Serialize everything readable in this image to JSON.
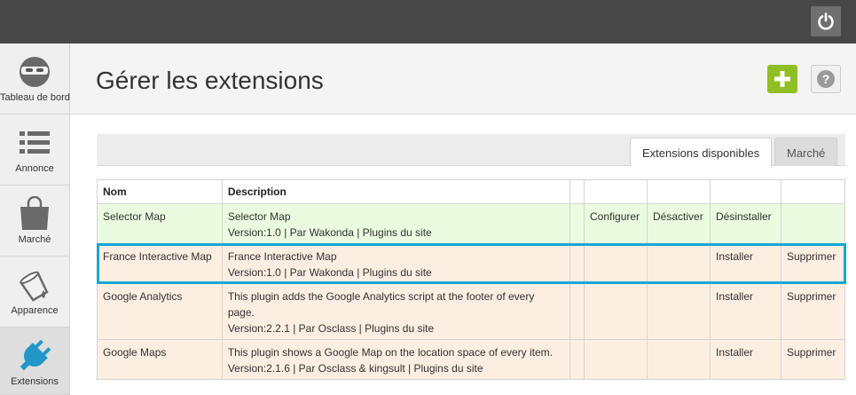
{
  "topbar": {
    "power_icon": "power-icon"
  },
  "sidebar": {
    "items": [
      {
        "label": "Tableau de bord",
        "icon": "ninja-icon"
      },
      {
        "label": "Annonce",
        "icon": "list-icon"
      },
      {
        "label": "Marché",
        "icon": "shopping-bag-icon"
      },
      {
        "label": "Apparence",
        "icon": "paint-bucket-icon"
      },
      {
        "label": "Extensions",
        "icon": "plug-icon"
      }
    ],
    "active": "Extensions"
  },
  "header": {
    "title": "Gérer les extensions",
    "add_icon": "plus-icon",
    "help_icon": "question-icon"
  },
  "tabs": [
    {
      "label": "Extensions disponibles",
      "active": true
    },
    {
      "label": "Marché",
      "active": false
    }
  ],
  "table": {
    "headers": [
      "Nom",
      "Description",
      "",
      "",
      "",
      "",
      ""
    ],
    "rows": [
      {
        "name": "Selector Map",
        "desc_line1": "Selector Map",
        "desc_line2": "Version:1.0 | Par Wakonda | Plugins du site",
        "desc_line3": "",
        "configure": "Configurer",
        "disable": "Désactiver",
        "action1": "Désinstaller",
        "action2": "",
        "status": "installed"
      },
      {
        "name": "France Interactive Map",
        "desc_line1": "France Interactive Map",
        "desc_line2": "Version:1.0 | Par Wakonda | Plugins du site",
        "desc_line3": "",
        "configure": "",
        "disable": "",
        "action1": "Installer",
        "action2": "Supprimer",
        "status": "not-installed",
        "selected": true
      },
      {
        "name": "Google Analytics",
        "desc_line1": "This plugin adds the Google Analytics script at the footer of every",
        "desc_line2": "page.",
        "desc_line3": "Version:2.2.1 | Par Osclass | Plugins du site",
        "configure": "",
        "disable": "",
        "action1": "Installer",
        "action2": "Supprimer",
        "status": "not-installed"
      },
      {
        "name": "Google Maps",
        "desc_line1": "This plugin shows a Google Map on the location space of every item.",
        "desc_line2": "Version:2.1.6 | Par Osclass & kingsult | Plugins du site",
        "desc_line3": "",
        "configure": "",
        "disable": "",
        "action1": "Installer",
        "action2": "Supprimer",
        "status": "not-installed"
      }
    ]
  },
  "colors": {
    "installed_row": "#ebfbdf",
    "available_row": "#fdeee2",
    "selection": "#1aa6d6",
    "add_button": "#8fbf23",
    "topbar": "#474747"
  }
}
